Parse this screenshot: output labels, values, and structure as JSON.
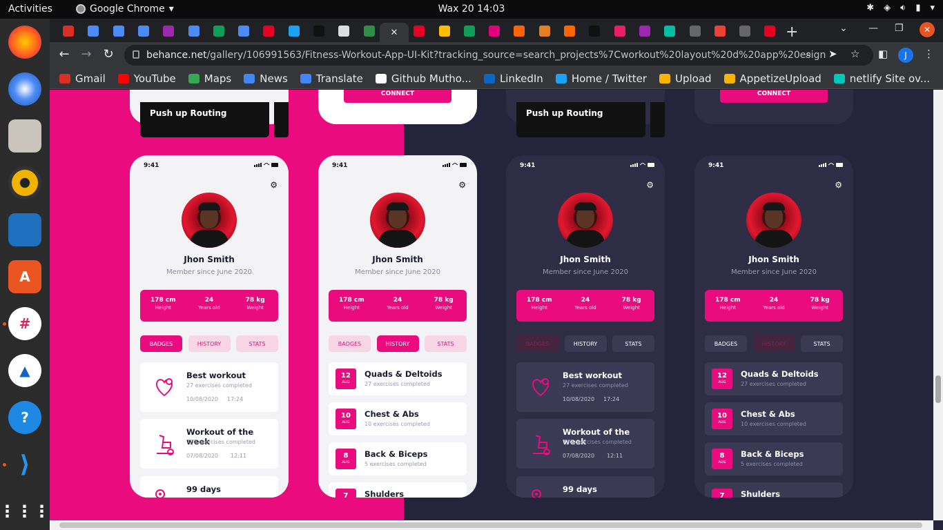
{
  "topbar": {
    "activities": "Activities",
    "app": "Google Chrome",
    "clock": "Wax 20  14:03"
  },
  "tabs": {
    "favicon_colors": [
      "#d93025",
      "#4c8bf5",
      "#4c8bf5",
      "#4c8bf5",
      "#9c27b0",
      "#4c8bf5",
      "#0f9d58",
      "#4c8bf5",
      "#e60023",
      "#1da1f2",
      "#111111",
      "#dddddd",
      "#2f8d46",
      "#ffffff",
      "#e60023",
      "#fbbc04",
      "#0f9d58",
      "#e2007a",
      "#ff6600",
      "#e67e22",
      "#ff6600",
      "#111111",
      "#e91e63",
      "#9c27b0",
      "#00bfa5",
      "#666666",
      "#ea4335",
      "#666666",
      "#e60023"
    ]
  },
  "url": {
    "domain": "behance.net",
    "path": "/gallery/106991563/Fitness-Workout-App-UI-Kit?tracking_source=search_projects%7Cworkout%20layout%20d%20app%20esign"
  },
  "profile_initial": "J",
  "bookmarks": [
    {
      "label": "Gmail",
      "color": "#d93025"
    },
    {
      "label": "YouTube",
      "color": "#ff0000"
    },
    {
      "label": "Maps",
      "color": "#34a853"
    },
    {
      "label": "News",
      "color": "#4285f4"
    },
    {
      "label": "Translate",
      "color": "#4285f4"
    },
    {
      "label": "Github Mutho...",
      "color": "#ffffff"
    },
    {
      "label": "LinkedIn",
      "color": "#0a66c2"
    },
    {
      "label": "Home / Twitter",
      "color": "#1da1f2"
    },
    {
      "label": "Upload",
      "color": "#f4b400"
    },
    {
      "label": "AppetizeUpload",
      "color": "#f4b400"
    },
    {
      "label": "netlify Site ov...",
      "color": "#00c7b7"
    }
  ],
  "phones": {
    "status_time": "9:41",
    "name": "Jhon Smith",
    "member": "Member since June 2020",
    "stats": [
      {
        "value": "178 cm",
        "label": "Height"
      },
      {
        "value": "24",
        "label": "Years old"
      },
      {
        "value": "78 kg",
        "label": "Weight"
      }
    ],
    "tabs": [
      "BADGES",
      "HISTORY",
      "STATS"
    ],
    "badges": [
      {
        "title": "Best workout",
        "sub": "27 exercises completed",
        "date": "10/08/2020",
        "time": "17:24"
      },
      {
        "title": "Workout of the week",
        "sub": "727 exercises completed",
        "date": "07/08/2020",
        "time": "12:11"
      },
      {
        "title": "99 days"
      }
    ],
    "history": [
      {
        "day": "12",
        "month": "AUG",
        "title": "Quads & Deltoids",
        "sub": "27 exercises completed"
      },
      {
        "day": "10",
        "month": "AUG",
        "title": "Chest & Abs",
        "sub": "10 exercises completed"
      },
      {
        "day": "8",
        "month": "AUG",
        "title": "Back & Biceps",
        "sub": "5 exercises completed"
      },
      {
        "day": "7",
        "month": "",
        "title": "Shulders",
        "sub": ""
      }
    ],
    "connect": "CONNECT",
    "push": "Push up Routing"
  },
  "accent": "#ea0b7f"
}
